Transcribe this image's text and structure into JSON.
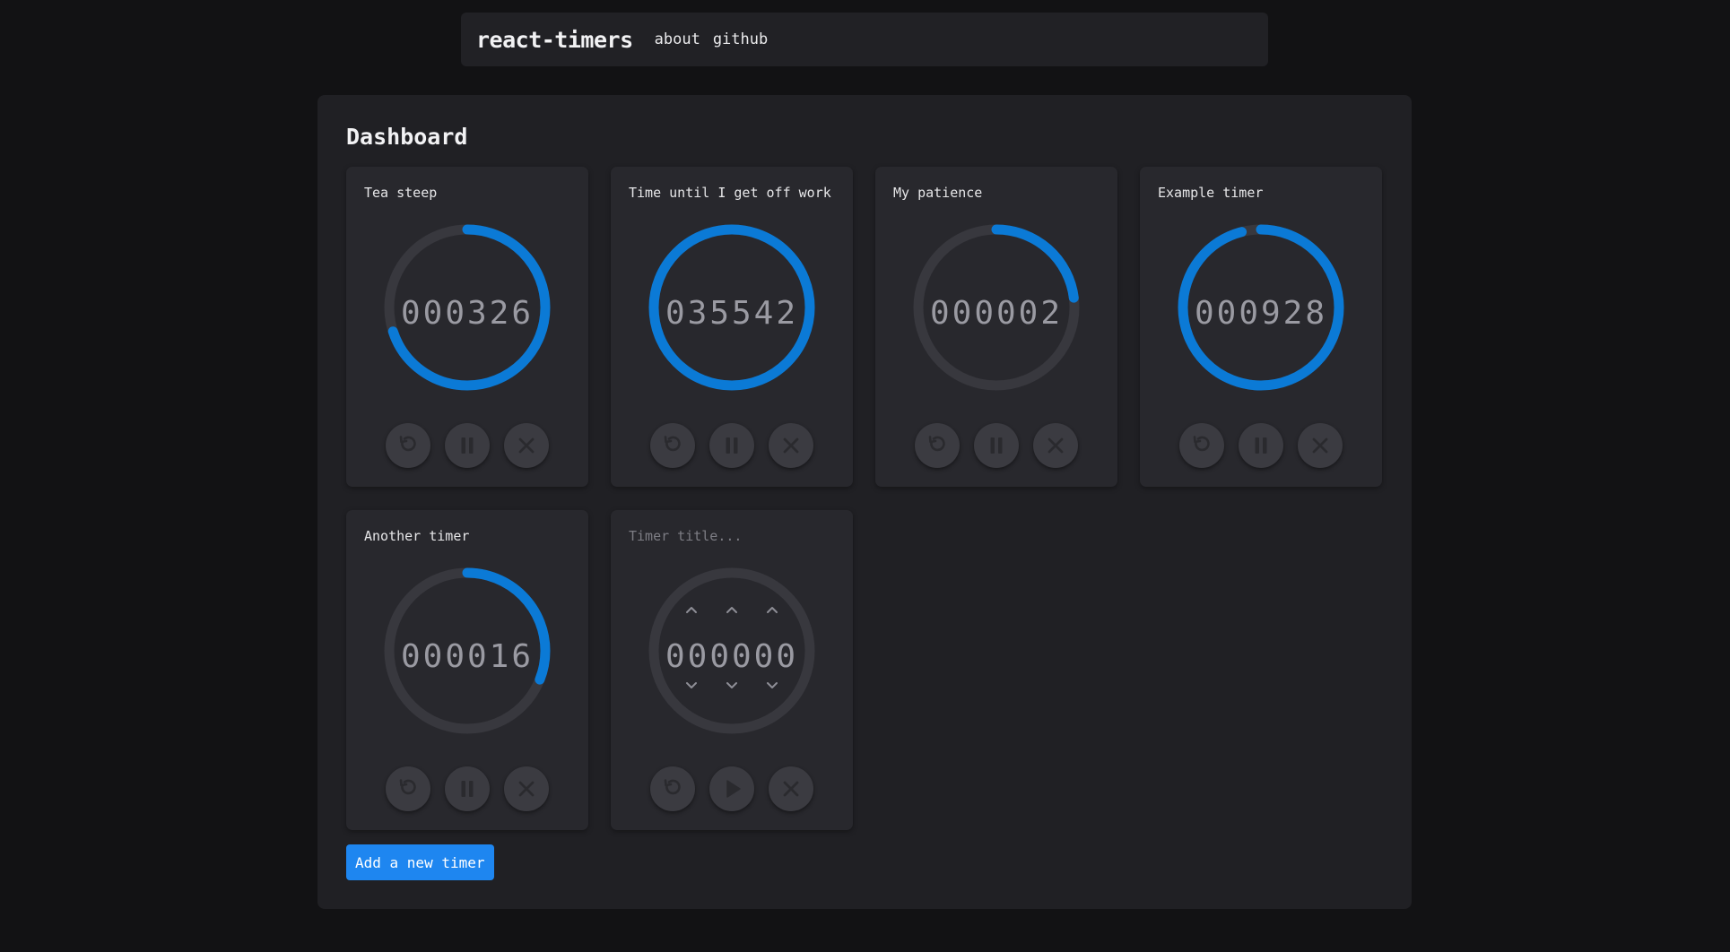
{
  "nav": {
    "brand": "react-timers",
    "links": [
      "about",
      "github"
    ]
  },
  "dashboard": {
    "title": "Dashboard"
  },
  "colors": {
    "accent": "#0b7ad6",
    "track": "#38383e",
    "button": "#3b3b41",
    "primary_button": "#1e86f0"
  },
  "timers": [
    {
      "title": "Tea steep",
      "digits": "000326",
      "progress": 0.7,
      "state": "running"
    },
    {
      "title": "Time until I get off work",
      "digits": "035542",
      "progress": 1.0,
      "state": "running"
    },
    {
      "title": "My patience",
      "digits": "000002",
      "progress": 0.23,
      "state": "running"
    },
    {
      "title": "Example timer",
      "digits": "000928",
      "progress": 0.96,
      "state": "running"
    },
    {
      "title": "Another timer",
      "digits": "000016",
      "progress": 0.31,
      "state": "running"
    }
  ],
  "new_timer": {
    "placeholder": "Timer title...",
    "digits": "000000"
  },
  "buttons": {
    "add_timer": "Add a new timer"
  },
  "icons": {
    "reset": "reset-icon",
    "pause": "pause-icon",
    "play": "play-icon",
    "delete": "close-icon",
    "increment": "chevron-up-icon",
    "decrement": "chevron-down-icon"
  }
}
